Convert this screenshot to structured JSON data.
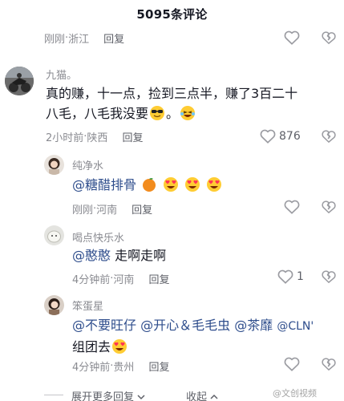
{
  "header": {
    "title": "5095条评论"
  },
  "top_partial": {
    "time": "刚刚",
    "location": "浙江",
    "reply": "回复"
  },
  "main_comment": {
    "username": "九猫。",
    "text_line1": "真的赚，十一点，捡到三点半，赚了3百二十",
    "text_line2": "八毛，八毛我没要",
    "text_end": "。",
    "emojis": [
      "cool-face-emoji",
      "laughing-tears-emoji"
    ],
    "time": "2小时前",
    "location": "陕西",
    "reply": "回复",
    "likes": "876"
  },
  "replies": [
    {
      "username": "纯净水",
      "mention": "@糖醋排骨",
      "emojis": [
        "orange-emoji",
        "heart-eyes-emoji",
        "heart-eyes-emoji",
        "heart-eyes-emoji"
      ],
      "time": "刚刚",
      "location": "河南",
      "reply": "回复",
      "likes": ""
    },
    {
      "username": "喝点快乐水",
      "mention": "@憨憨",
      "text": " 走啊走啊",
      "time": "4分钟前",
      "location": "河南",
      "reply": "回复",
      "likes": "1"
    },
    {
      "username": "笨蛋星",
      "mentions": [
        "@不要旺仔",
        "@开心＆毛毛虫",
        "@茶靡",
        "@CLN'"
      ],
      "text_line2": "组团去",
      "emojis": [
        "heart-eyes-emoji"
      ],
      "time": "4分钟前",
      "location": "贵州",
      "reply": "回复",
      "likes": ""
    }
  ],
  "footer": {
    "expand_more": "展开更多回复",
    "collapse": "收起"
  },
  "watermark": "@文创视频",
  "colors": {
    "text": "#161823",
    "meta": "#8a8b91",
    "mention": "#2e4d8c",
    "icon": "#9a9ba1"
  }
}
